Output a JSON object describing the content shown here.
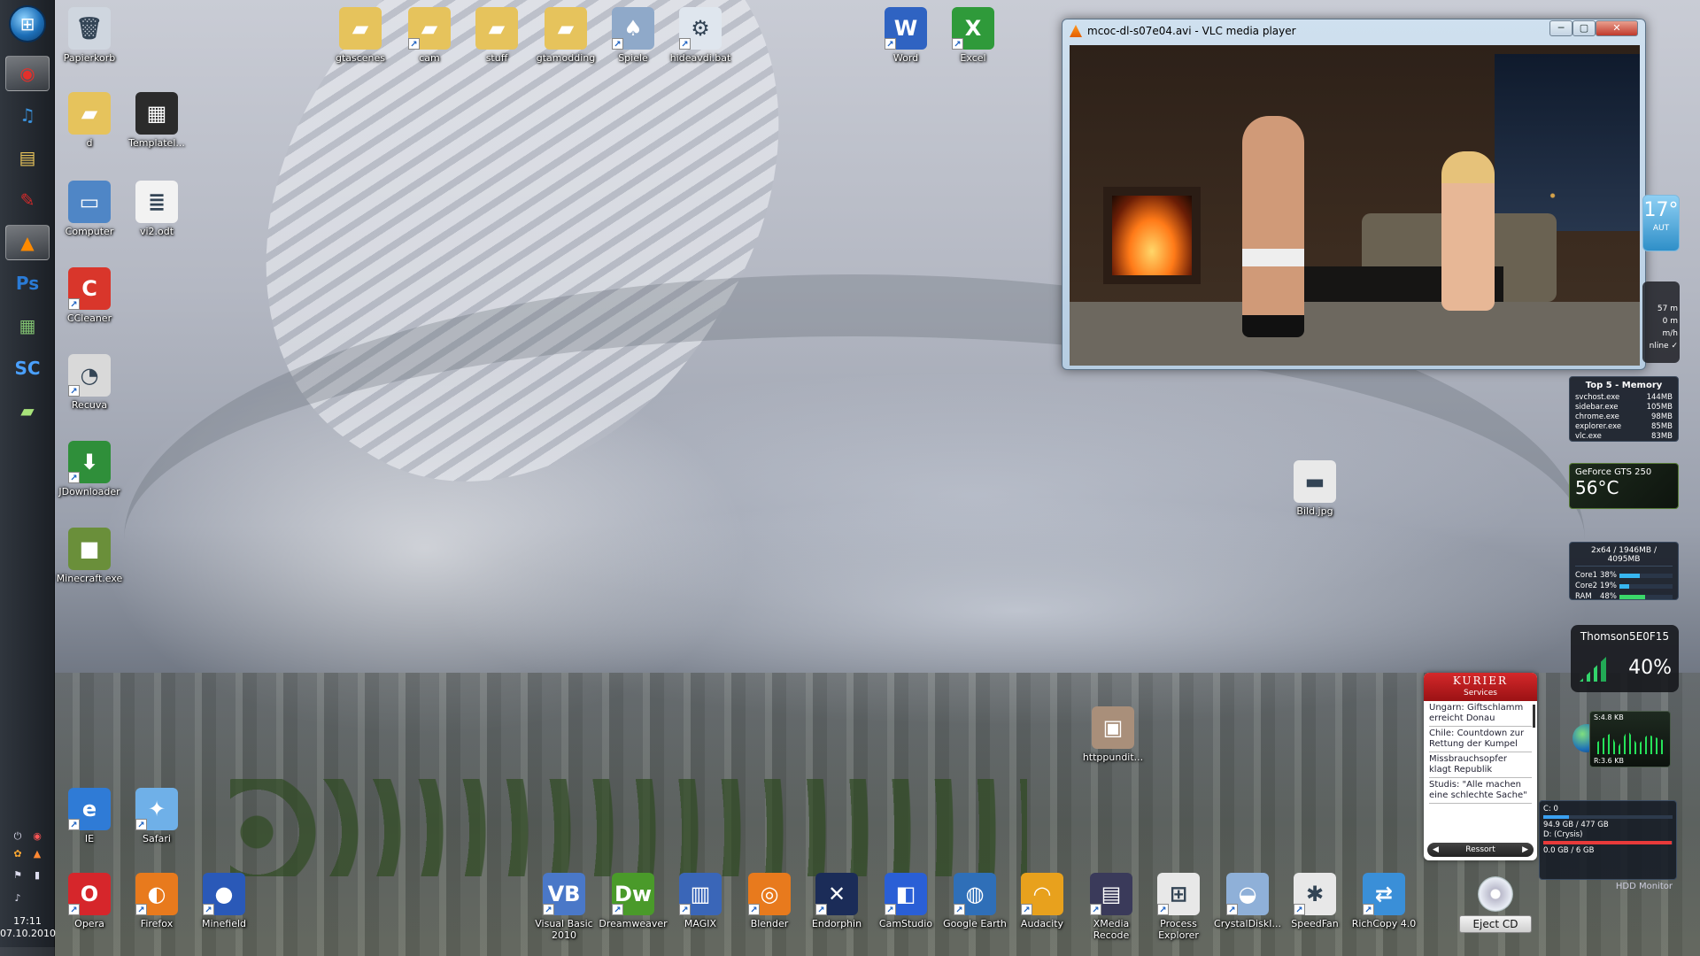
{
  "taskbar": {
    "pinned": [
      {
        "name": "chrome",
        "glyph": "◉",
        "color": "#e3302b"
      },
      {
        "name": "itunes",
        "glyph": "♫",
        "color": "#3a8fd8"
      },
      {
        "name": "explorer",
        "glyph": "▤",
        "color": "#e8c45a"
      },
      {
        "name": "acrobat",
        "glyph": "✎",
        "color": "#d62a2a"
      },
      {
        "name": "vlc",
        "glyph": "▲",
        "color": "#ff8a00"
      },
      {
        "name": "photoshop",
        "glyph": "Ps",
        "color": "#2a7bd6"
      },
      {
        "name": "task-manager",
        "glyph": "▦",
        "color": "#7fbf6f"
      },
      {
        "name": "starcraft",
        "glyph": "SC",
        "color": "#4aa0ff"
      },
      {
        "name": "sticky-notes",
        "glyph": "▰",
        "color": "#a8e37a"
      }
    ],
    "clock_time": "17:11",
    "clock_date": "07.10.2010"
  },
  "desktop_icons": [
    {
      "label": "Papierkorb",
      "glyph": "🗑",
      "color": "#cfd6df"
    },
    {
      "label": "d",
      "glyph": "▰",
      "color": "#e6c35c"
    },
    {
      "label": "Templatel...",
      "glyph": "▦",
      "color": "#2b2b2b"
    },
    {
      "label": "Computer",
      "glyph": "▭",
      "color": "#4f86c6"
    },
    {
      "label": "vi2.odt",
      "glyph": "≣",
      "color": "#f2f2f2"
    },
    {
      "label": "CCleaner",
      "glyph": "C",
      "color": "#d9362b"
    },
    {
      "label": "Recuva",
      "glyph": "◔",
      "color": "#d9d9d9"
    },
    {
      "label": "JDownloader",
      "glyph": "⬇",
      "color": "#2f8f3a"
    },
    {
      "label": "Minecraft.exe",
      "glyph": "■",
      "color": "#6a8f3a"
    },
    {
      "label": "IE",
      "glyph": "e",
      "color": "#2f7bd6"
    },
    {
      "label": "Safari",
      "glyph": "✦",
      "color": "#6fb0e8"
    },
    {
      "label": "gtascenes",
      "glyph": "▰",
      "color": "#e6c35c"
    },
    {
      "label": "cam",
      "glyph": "▰",
      "color": "#e6c35c"
    },
    {
      "label": "stuff",
      "glyph": "▰",
      "color": "#e6c35c"
    },
    {
      "label": "gtamodding",
      "glyph": "▰",
      "color": "#e6c35c"
    },
    {
      "label": "Spiele",
      "glyph": "♠",
      "color": "#8fa9c9"
    },
    {
      "label": "hideavdi.bat",
      "glyph": "⚙",
      "color": "#dfe6ee"
    },
    {
      "label": "Word",
      "glyph": "W",
      "color": "#2f63c2"
    },
    {
      "label": "Excel",
      "glyph": "X",
      "color": "#2f9a3a"
    },
    {
      "label": "Bild.jpg",
      "glyph": "▬",
      "color": "#e9e9e9"
    },
    {
      "label": "httppundit...",
      "glyph": "▣",
      "color": "#a98f7a"
    },
    {
      "label": "Opera",
      "glyph": "O",
      "color": "#d6262b"
    },
    {
      "label": "Firefox",
      "glyph": "◐",
      "color": "#e87a1d"
    },
    {
      "label": "Minefield",
      "glyph": "●",
      "color": "#2a59b8"
    },
    {
      "label": "Visual Basic 2010",
      "glyph": "VB",
      "color": "#4a78c8"
    },
    {
      "label": "Dreamweaver",
      "glyph": "Dw",
      "color": "#4a9a2a"
    },
    {
      "label": "MAGIX",
      "glyph": "▥",
      "color": "#3a66b8"
    },
    {
      "label": "Blender",
      "glyph": "◎",
      "color": "#e87a1d"
    },
    {
      "label": "Endorphin",
      "glyph": "✕",
      "color": "#1b2c58"
    },
    {
      "label": "CamStudio",
      "glyph": "◧",
      "color": "#2a5fd6"
    },
    {
      "label": "Google Earth",
      "glyph": "◍",
      "color": "#2f6fb8"
    },
    {
      "label": "Audacity",
      "glyph": "◠",
      "color": "#e8a11d"
    },
    {
      "label": "XMedia Recode",
      "glyph": "▤",
      "color": "#3a3a5a"
    },
    {
      "label": "Process Explorer",
      "glyph": "⊞",
      "color": "#e8e8e8"
    },
    {
      "label": "CrystalDiskI...",
      "glyph": "◒",
      "color": "#8fb0d8"
    },
    {
      "label": "SpeedFan",
      "glyph": "✱",
      "color": "#e8e8e8"
    },
    {
      "label": "RichCopy 4.0",
      "glyph": "⇄",
      "color": "#3a8fd8"
    }
  ],
  "vlc": {
    "title": "mcoc-dl-s07e04.avi - VLC media player",
    "minimize": "─",
    "maximize": "▢",
    "close": "✕"
  },
  "gadgets": {
    "temperature": {
      "value": "17°",
      "unit": "AUT"
    },
    "weather_rows": [
      "57 m",
      "0 m",
      "m/h",
      "nline ✓"
    ],
    "memory": {
      "title": "Top 5 - Memory",
      "rows": [
        {
          "proc": "svchost.exe",
          "mem": "144MB"
        },
        {
          "proc": "sidebar.exe",
          "mem": "105MB"
        },
        {
          "proc": "chrome.exe",
          "mem": "98MB"
        },
        {
          "proc": "explorer.exe",
          "mem": "85MB"
        },
        {
          "proc": "vlc.exe",
          "mem": "83MB"
        }
      ]
    },
    "gpu": {
      "name": "GeForce GTS 250",
      "temp": "56°C"
    },
    "cpu": {
      "header": "2x64 / 1946MB / 4095MB",
      "rows": [
        {
          "name": "Core1",
          "pct": "38%",
          "value": 38
        },
        {
          "name": "Core2",
          "pct": "19%",
          "value": 19
        },
        {
          "name": "RAM",
          "pct": "48%",
          "value": 48
        }
      ]
    },
    "wifi": {
      "ssid": "Thomson5E0F15",
      "pct": "40%"
    },
    "net": {
      "send": "S:4.8 KB",
      "recv": "R:3.6 KB"
    },
    "hdd": {
      "c_label": "C: 0",
      "c_usage": "94.9 GB / 477 GB",
      "c_fill": 0.2,
      "d_label": "D: (Crysis)",
      "d_usage": "0.0 GB / 6 GB",
      "d_fill": 0.99,
      "footer": "HDD Monitor"
    }
  },
  "kurier": {
    "brand": "KURIER",
    "sub": "Services",
    "items": [
      "Ungarn: Giftschlamm erreicht Donau",
      "Chile: Countdown zur Rettung der Kumpel",
      "Missbrauchsopfer klagt Republik",
      "Studis: \"Alle machen eine schlechte Sache\""
    ],
    "footer": "Ressort",
    "prev": "◀",
    "next": "▶"
  },
  "eject": {
    "label": "Eject CD"
  }
}
